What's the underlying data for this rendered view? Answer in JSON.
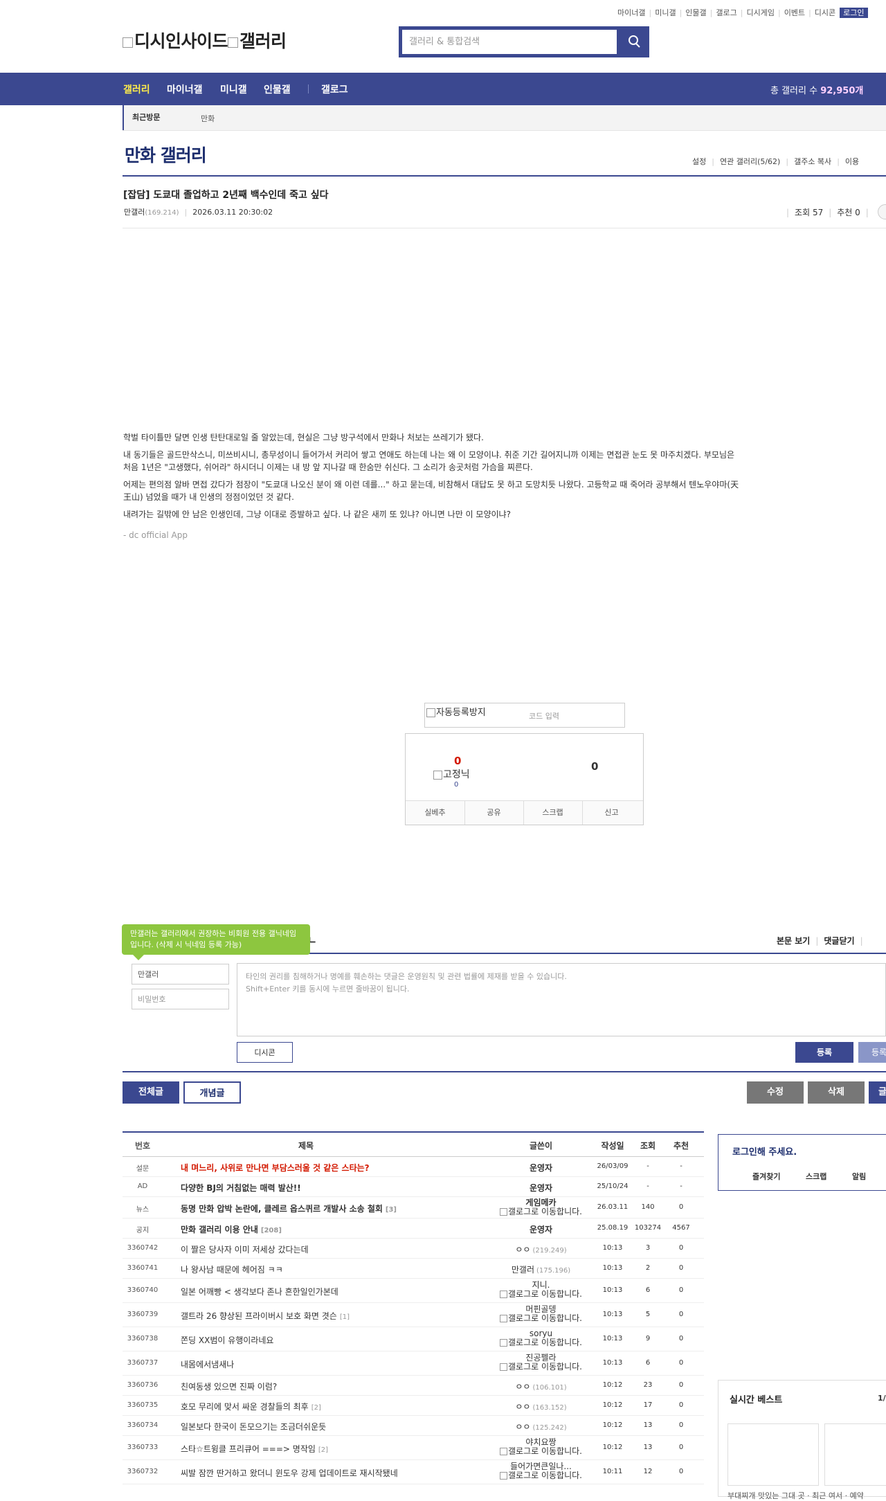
{
  "top_links": [
    "마이너갤",
    "미니갤",
    "인물갤",
    "갤로그",
    "디시게임",
    "이벤트",
    "디시콘"
  ],
  "login_label": "로그인",
  "logo": {
    "part1": "디시인사이드",
    "part2": "갤러리"
  },
  "search": {
    "placeholder": "갤러리 & 통합검색"
  },
  "nav": {
    "items": [
      "갤러리",
      "마이너갤",
      "미니갤",
      "인물갤",
      "갤로그"
    ],
    "total_label": "총 갤러리 수",
    "total_value": "92,950개"
  },
  "recent": {
    "label": "최근방문",
    "gallery": "만화"
  },
  "gallery": {
    "title": "만화 갤러리",
    "tools": [
      "설정",
      "연관 갤러리(5/62)",
      "갤주소 복사",
      "이용"
    ]
  },
  "post": {
    "title": "[잡담] 도쿄대 졸업하고 2년째 백수인데 죽고 싶다",
    "author": "만갤러",
    "ip": "(169.214)",
    "date": "2026.03.11 20:30:02",
    "views_label": "조회 57",
    "recommend_label": "추천 0",
    "paragraphs": [
      "학벌 타이틀만 달면 인생 탄탄대로일 줄 알았는데, 현실은 그냥 방구석에서 만화나 처보는 쓰레기가 됐다.",
      "내 동기들은 골드만삭스니, 미쓰비시니, 총무성이니 들어가서 커리어 쌓고 연애도 하는데 나는 왜 이 모양이냐. 취준 기간 길어지니까 이제는 면접관 눈도 못 마주치겠다. 부모님은 처음 1년은 \"고생했다, 쉬어라\" 하시더니 이제는 내 방 앞 지나갈 때 한숨만 쉬신다. 그 소리가 송곳처럼 가슴을 찌른다.",
      "어제는 편의점 알바 면접 갔다가 점장이 \"도쿄대 나오신 분이 왜 이런 데를...\" 하고 묻는데, 비참해서 대답도 못 하고 도망치듯 나왔다. 고등학교 때 죽어라 공부해서 텐노우야마(天王山) 넘었을 때가 내 인생의 정점이었던 것 같다.",
      "내려가는 길밖에 안 남은 인생인데, 그냥 이대로 증발하고 싶다. 나 같은 새끼 또 있냐? 아니면 나만 이 모양이냐?"
    ],
    "signature": "- dc official App"
  },
  "captcha": {
    "image_alt": "자동등록방지",
    "placeholder": "코드 입력"
  },
  "recommend_box": {
    "up": "0",
    "fixed_alt": "고정닉",
    "fixed_count": "0",
    "down": "0",
    "buttons": [
      "실베추",
      "공유",
      "스크랩",
      "신고"
    ]
  },
  "comment": {
    "tooltip": "만갤러는 갤러리에서 권장하는 비회원 전용 갤닉네임입니다. (삭제 시 닉네임 등록 가능)",
    "title_partial": "Iㅡ",
    "links": [
      "본문 보기",
      "댓글닫기"
    ],
    "nick_value": "만갤러",
    "pw_placeholder": "비밀번호",
    "textarea_line1": "타인의 권리를 침해하거나 명예를 훼손하는 댓글은 운영원칙 및 관련 법률에 제재를 받을 수 있습니다.",
    "textarea_line2": "Shift+Enter 키를 동시에 누르면 줄바꿈이 됩니다.",
    "dccon_label": "디시콘",
    "register_label": "등록",
    "register2_label": "등록"
  },
  "list_buttons": {
    "all": "전체글",
    "recommend": "개념글",
    "edit": "수정",
    "delete": "삭제",
    "write": "글"
  },
  "table": {
    "headers": {
      "num": "번호",
      "subject": "제목",
      "writer": "글쓴이",
      "date": "작성일",
      "views": "조회",
      "rec": "추천"
    },
    "rows": [
      {
        "num": "설문",
        "subject": "내 며느리, 사위로 만나면 부담스러울 것 같은 스타는?",
        "cm": "",
        "writer": "운영자",
        "ip": "",
        "date": "26/03/09",
        "views": "-",
        "rec": "-",
        "style": "survey"
      },
      {
        "num": "AD",
        "subject": "다양한 BJ의 거침없는 매력 발산!!",
        "cm": "",
        "writer": "운영자",
        "ip": "",
        "date": "25/10/24",
        "views": "-",
        "rec": "-",
        "style": "bold"
      },
      {
        "num": "뉴스",
        "subject": "동명 만화 압박 논란에, 클레르 옵스퀴르 개발사 소송 철회",
        "cm": "[3]",
        "writer": "게임메카",
        "gallog": "갤로그로 이동합니다.",
        "date": "26.03.11",
        "views": "140",
        "rec": "0",
        "style": "bold2"
      },
      {
        "num": "공지",
        "subject": "만화 갤러리 이용 안내",
        "cm": "[208]",
        "writer": "운영자",
        "ip": "",
        "date": "25.08.19",
        "views": "103274",
        "rec": "4567",
        "style": "bold"
      },
      {
        "num": "3360742",
        "subject": "이 짤은 당사자 이미 저세상 갔다는데",
        "cm": "",
        "writer": "ㅇㅇ",
        "ip": "(219.249)",
        "date": "10:13",
        "views": "3",
        "rec": "0"
      },
      {
        "num": "3360741",
        "subject": "나 왕사남 때문에 헤어짐 ㅋㅋ",
        "cm": "",
        "writer": "만갤러",
        "ip": "(175.196)",
        "date": "10:13",
        "views": "2",
        "rec": "0"
      },
      {
        "num": "3360740",
        "subject": "일본 어깨빵 < 생각보다 존나 흔한일인가본데",
        "cm": "",
        "writer": "지니.",
        "gallog": "갤로그로 이동합니다.",
        "date": "10:13",
        "views": "6",
        "rec": "0"
      },
      {
        "num": "3360739",
        "subject": "갤트라 26 향상된 프라이버시 보호 화면 겻슨",
        "cm": "[1]",
        "writer": "머핀골뎅",
        "gallog": "갤로그로 이동합니다.",
        "date": "10:13",
        "views": "5",
        "rec": "0"
      },
      {
        "num": "3360738",
        "subject": "쫀딩 XX범이 유행이라네요",
        "cm": "",
        "writer": "soryu",
        "gallog": "갤로그로 이동합니다.",
        "date": "10:13",
        "views": "9",
        "rec": "0"
      },
      {
        "num": "3360737",
        "subject": "내몸에서냄새나",
        "cm": "",
        "writer": "진공펠라",
        "gallog": "갤로그로 이동합니다.",
        "date": "10:13",
        "views": "6",
        "rec": "0"
      },
      {
        "num": "3360736",
        "subject": "친여동생 있으면 진짜 이럼?",
        "cm": "",
        "writer": "ㅇㅇ",
        "ip": "(106.101)",
        "date": "10:12",
        "views": "23",
        "rec": "0"
      },
      {
        "num": "3360735",
        "subject": "호모 무리에 맞서 싸운 경찰들의 최후",
        "cm": "[2]",
        "writer": "ㅇㅇ",
        "ip": "(163.152)",
        "date": "10:12",
        "views": "17",
        "rec": "0"
      },
      {
        "num": "3360734",
        "subject": "일본보다 한국이 돈모으기는 조금더쉬운듯",
        "cm": "",
        "writer": "ㅇㅇ",
        "ip": "(125.242)",
        "date": "10:12",
        "views": "13",
        "rec": "0"
      },
      {
        "num": "3360733",
        "subject": "스타☆트윙클 프리큐어 ===> 명작임",
        "cm": "[2]",
        "writer": "야치요짱",
        "gallog": "갤로그로 이동합니다.",
        "date": "10:12",
        "views": "13",
        "rec": "0"
      },
      {
        "num": "3360732",
        "subject": "씨발 잠깐 딴거하고 왔더니 윈도우 강제 업데이트로 재시작됐네",
        "cm": "",
        "writer": "들어가면큰일나...",
        "gallog": "갤로그로 이동합니다.",
        "date": "10:11",
        "views": "12",
        "rec": "0"
      }
    ]
  },
  "sidebar": {
    "login_prompt": "로그인해 주세요.",
    "login_links": [
      "즐겨찾기",
      "스크랩",
      "알림"
    ],
    "best_title": "실시간 베스트",
    "best_page": "1/",
    "best_caption": "부대찌개 맛있는 그대 곳 · 최근 여서 · 예약"
  }
}
